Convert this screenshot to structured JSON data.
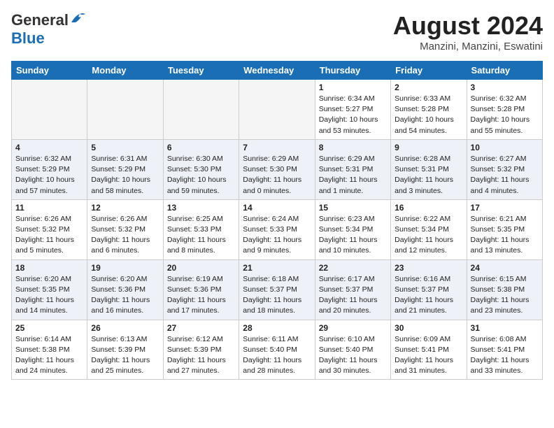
{
  "header": {
    "logo_line1": "General",
    "logo_line2": "Blue",
    "month_year": "August 2024",
    "location": "Manzini, Manzini, Eswatini"
  },
  "weekdays": [
    "Sunday",
    "Monday",
    "Tuesday",
    "Wednesday",
    "Thursday",
    "Friday",
    "Saturday"
  ],
  "weeks": [
    [
      {
        "day": "",
        "info": ""
      },
      {
        "day": "",
        "info": ""
      },
      {
        "day": "",
        "info": ""
      },
      {
        "day": "",
        "info": ""
      },
      {
        "day": "1",
        "info": "Sunrise: 6:34 AM\nSunset: 5:27 PM\nDaylight: 10 hours\nand 53 minutes."
      },
      {
        "day": "2",
        "info": "Sunrise: 6:33 AM\nSunset: 5:28 PM\nDaylight: 10 hours\nand 54 minutes."
      },
      {
        "day": "3",
        "info": "Sunrise: 6:32 AM\nSunset: 5:28 PM\nDaylight: 10 hours\nand 55 minutes."
      }
    ],
    [
      {
        "day": "4",
        "info": "Sunrise: 6:32 AM\nSunset: 5:29 PM\nDaylight: 10 hours\nand 57 minutes."
      },
      {
        "day": "5",
        "info": "Sunrise: 6:31 AM\nSunset: 5:29 PM\nDaylight: 10 hours\nand 58 minutes."
      },
      {
        "day": "6",
        "info": "Sunrise: 6:30 AM\nSunset: 5:30 PM\nDaylight: 10 hours\nand 59 minutes."
      },
      {
        "day": "7",
        "info": "Sunrise: 6:29 AM\nSunset: 5:30 PM\nDaylight: 11 hours\nand 0 minutes."
      },
      {
        "day": "8",
        "info": "Sunrise: 6:29 AM\nSunset: 5:31 PM\nDaylight: 11 hours\nand 1 minute."
      },
      {
        "day": "9",
        "info": "Sunrise: 6:28 AM\nSunset: 5:31 PM\nDaylight: 11 hours\nand 3 minutes."
      },
      {
        "day": "10",
        "info": "Sunrise: 6:27 AM\nSunset: 5:32 PM\nDaylight: 11 hours\nand 4 minutes."
      }
    ],
    [
      {
        "day": "11",
        "info": "Sunrise: 6:26 AM\nSunset: 5:32 PM\nDaylight: 11 hours\nand 5 minutes."
      },
      {
        "day": "12",
        "info": "Sunrise: 6:26 AM\nSunset: 5:32 PM\nDaylight: 11 hours\nand 6 minutes."
      },
      {
        "day": "13",
        "info": "Sunrise: 6:25 AM\nSunset: 5:33 PM\nDaylight: 11 hours\nand 8 minutes."
      },
      {
        "day": "14",
        "info": "Sunrise: 6:24 AM\nSunset: 5:33 PM\nDaylight: 11 hours\nand 9 minutes."
      },
      {
        "day": "15",
        "info": "Sunrise: 6:23 AM\nSunset: 5:34 PM\nDaylight: 11 hours\nand 10 minutes."
      },
      {
        "day": "16",
        "info": "Sunrise: 6:22 AM\nSunset: 5:34 PM\nDaylight: 11 hours\nand 12 minutes."
      },
      {
        "day": "17",
        "info": "Sunrise: 6:21 AM\nSunset: 5:35 PM\nDaylight: 11 hours\nand 13 minutes."
      }
    ],
    [
      {
        "day": "18",
        "info": "Sunrise: 6:20 AM\nSunset: 5:35 PM\nDaylight: 11 hours\nand 14 minutes."
      },
      {
        "day": "19",
        "info": "Sunrise: 6:20 AM\nSunset: 5:36 PM\nDaylight: 11 hours\nand 16 minutes."
      },
      {
        "day": "20",
        "info": "Sunrise: 6:19 AM\nSunset: 5:36 PM\nDaylight: 11 hours\nand 17 minutes."
      },
      {
        "day": "21",
        "info": "Sunrise: 6:18 AM\nSunset: 5:37 PM\nDaylight: 11 hours\nand 18 minutes."
      },
      {
        "day": "22",
        "info": "Sunrise: 6:17 AM\nSunset: 5:37 PM\nDaylight: 11 hours\nand 20 minutes."
      },
      {
        "day": "23",
        "info": "Sunrise: 6:16 AM\nSunset: 5:37 PM\nDaylight: 11 hours\nand 21 minutes."
      },
      {
        "day": "24",
        "info": "Sunrise: 6:15 AM\nSunset: 5:38 PM\nDaylight: 11 hours\nand 23 minutes."
      }
    ],
    [
      {
        "day": "25",
        "info": "Sunrise: 6:14 AM\nSunset: 5:38 PM\nDaylight: 11 hours\nand 24 minutes."
      },
      {
        "day": "26",
        "info": "Sunrise: 6:13 AM\nSunset: 5:39 PM\nDaylight: 11 hours\nand 25 minutes."
      },
      {
        "day": "27",
        "info": "Sunrise: 6:12 AM\nSunset: 5:39 PM\nDaylight: 11 hours\nand 27 minutes."
      },
      {
        "day": "28",
        "info": "Sunrise: 6:11 AM\nSunset: 5:40 PM\nDaylight: 11 hours\nand 28 minutes."
      },
      {
        "day": "29",
        "info": "Sunrise: 6:10 AM\nSunset: 5:40 PM\nDaylight: 11 hours\nand 30 minutes."
      },
      {
        "day": "30",
        "info": "Sunrise: 6:09 AM\nSunset: 5:41 PM\nDaylight: 11 hours\nand 31 minutes."
      },
      {
        "day": "31",
        "info": "Sunrise: 6:08 AM\nSunset: 5:41 PM\nDaylight: 11 hours\nand 33 minutes."
      }
    ]
  ]
}
